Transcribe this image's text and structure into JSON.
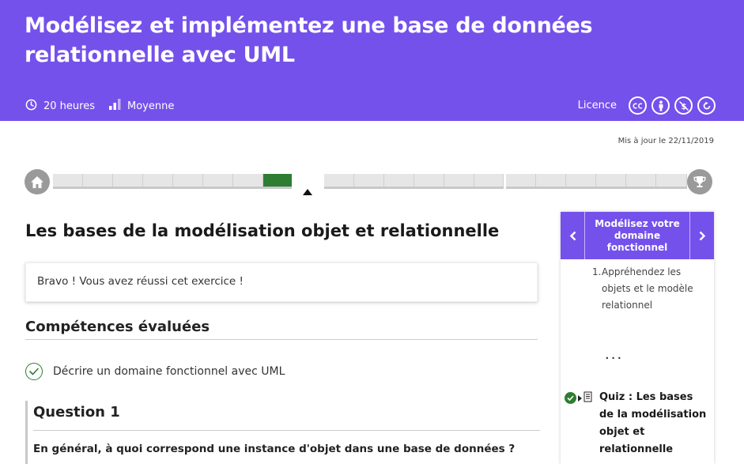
{
  "course": {
    "title": "Modélisez et implémentez une base de données relationnelle avec UML",
    "duration": "20 heures",
    "level": "Moyenne",
    "licence_label": "Licence",
    "licence_icons": [
      "cc-icon",
      "by-icon",
      "nc-icon",
      "sa-icon"
    ]
  },
  "updated": "Mis à jour le 22/11/2019",
  "colors": {
    "brand": "#7451eb",
    "success": "#2e7d32"
  },
  "main": {
    "section_title": "Les bases de la modélisation objet et relationnelle",
    "alert": "Bravo ! Vous avez réussi cet exercice !",
    "skills_title": "Compétences évaluées",
    "skill_1": "Décrire un domaine fonctionnel avec UML",
    "question_title": "Question 1",
    "question_text": "En général, à quoi correspond une instance d'objet dans une base de données ?"
  },
  "sidebar": {
    "title": "Modélisez votre domaine fonctionnel",
    "item_1_number": "1.",
    "item_1_text": "Appréhendez les objets et le modèle relationnel",
    "ellipsis": "...",
    "quiz_label": "Quiz : Les bases de la modélisation objet et relationnelle"
  }
}
